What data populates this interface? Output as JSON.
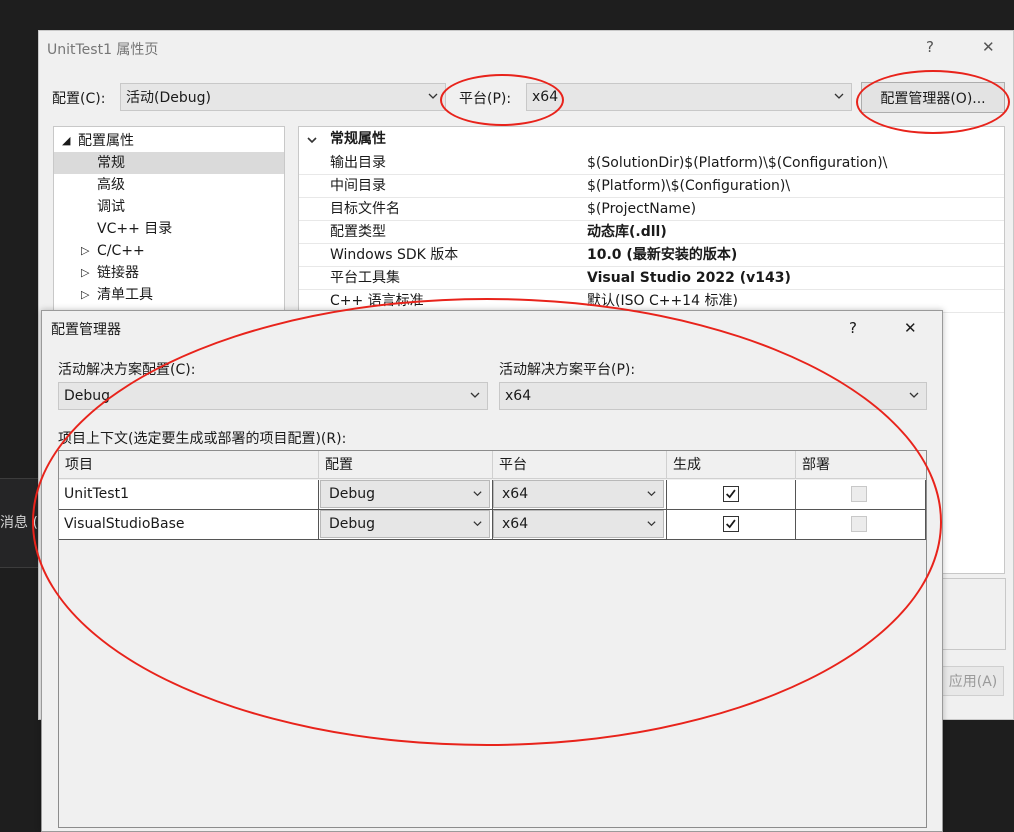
{
  "background": {
    "ide_text": "消息 ("
  },
  "property_pages": {
    "title": "UnitTest1 属性页",
    "help": "?",
    "close": "✕",
    "config_label": "配置(C):",
    "config_value": "活动(Debug)",
    "platform_label": "平台(P):",
    "platform_value": "x64",
    "config_manager_button": "配置管理器(O)...",
    "tree": [
      {
        "label": "配置属性",
        "expander": "◢",
        "level": 0,
        "selected": false
      },
      {
        "label": "常规",
        "expander": "",
        "level": 1,
        "selected": true
      },
      {
        "label": "高级",
        "expander": "",
        "level": 1,
        "selected": false
      },
      {
        "label": "调试",
        "expander": "",
        "level": 1,
        "selected": false
      },
      {
        "label": "VC++ 目录",
        "expander": "",
        "level": 1,
        "selected": false
      },
      {
        "label": "C/C++",
        "expander": "▷",
        "level": 1,
        "selected": false
      },
      {
        "label": "链接器",
        "expander": "▷",
        "level": 1,
        "selected": false
      },
      {
        "label": "清单工具",
        "expander": "▷",
        "level": 1,
        "selected": false
      }
    ],
    "section_header": "常规属性",
    "properties": [
      {
        "name": "输出目录",
        "value": "$(SolutionDir)$(Platform)\\$(Configuration)\\",
        "bold": false
      },
      {
        "name": "中间目录",
        "value": "$(Platform)\\$(Configuration)\\",
        "bold": false
      },
      {
        "name": "目标文件名",
        "value": "$(ProjectName)",
        "bold": false
      },
      {
        "name": "配置类型",
        "value": "动态库(.dll)",
        "bold": true
      },
      {
        "name": "Windows SDK 版本",
        "value": "10.0 (最新安装的版本)",
        "bold": true
      },
      {
        "name": "平台工具集",
        "value": "Visual Studio 2022 (v143)",
        "bold": true
      },
      {
        "name": "C++ 语言标准",
        "value": "默认(ISO C++14 标准)",
        "bold": false
      }
    ],
    "apply_button": "应用(A)"
  },
  "config_manager": {
    "title": "配置管理器",
    "help": "?",
    "close": "✕",
    "solution_config_label": "活动解决方案配置(C):",
    "solution_config_value": "Debug",
    "solution_platform_label": "活动解决方案平台(P):",
    "solution_platform_value": "x64",
    "project_context_label": "项目上下文(选定要生成或部署的项目配置)(R):",
    "columns": [
      "项目",
      "配置",
      "平台",
      "生成",
      "部署"
    ],
    "rows": [
      {
        "project": "UnitTest1",
        "configuration": "Debug",
        "platform": "x64",
        "build": true,
        "deploy": false
      },
      {
        "project": "VisualStudioBase",
        "configuration": "Debug",
        "platform": "x64",
        "build": true,
        "deploy": false
      }
    ]
  },
  "colors": {
    "annotation_red": "#e8231b",
    "dialog_bg": "#f0f0f0",
    "selection_gray": "#dadada"
  }
}
